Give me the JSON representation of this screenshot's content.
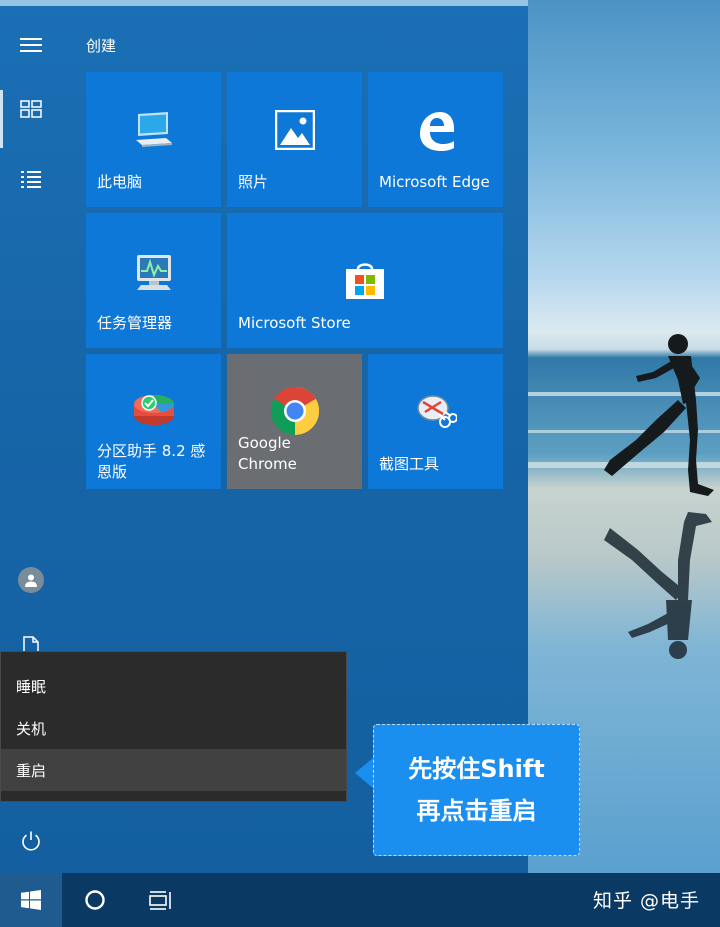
{
  "start_menu": {
    "group_title": "创建",
    "tiles": {
      "this_pc": "此电脑",
      "photos": "照片",
      "edge": "Microsoft Edge",
      "task_manager": "任务管理器",
      "store": "Microsoft Store",
      "partition_assistant": "分区助手 8.2 感恩版",
      "chrome": "Google Chrome",
      "snipping_tool": "截图工具"
    }
  },
  "power_menu": {
    "items": [
      "睡眠",
      "关机",
      "重启"
    ],
    "highlighted": "重启"
  },
  "callout": {
    "line1": "先按住Shift",
    "line2": "再点击重启"
  },
  "watermark": "知乎 @电手",
  "colors": {
    "accent_tile": "#0d78d8",
    "chrome_tile": "#6a6e72",
    "callout": "#1a8ff0",
    "taskbar": "#0a3a63"
  }
}
